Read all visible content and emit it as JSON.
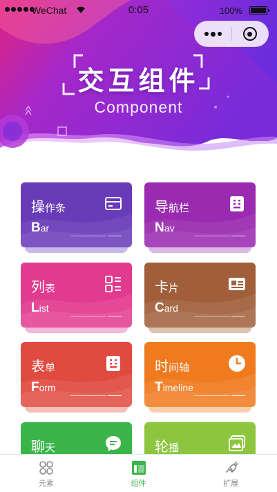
{
  "status_bar": {
    "carrier": "WeChat",
    "time": "0:05",
    "battery": "100%"
  },
  "capsule": {
    "more_icon": "more-dots-icon",
    "close_icon": "close-circle-icon"
  },
  "header": {
    "title_cn": "交互组件",
    "title_en": "Component",
    "gradient_from": "#e1237f",
    "gradient_to": "#7a2bd9"
  },
  "cards": [
    {
      "title_big": "操",
      "title_small": "作条",
      "sub_big": "B",
      "sub_small": "ar",
      "icon": "card-icon",
      "color": "#6a3bb8",
      "color2": "#7f48c9"
    },
    {
      "title_big": "导",
      "title_small": "航栏",
      "sub_big": "N",
      "sub_small": "av",
      "icon": "navigation-icon",
      "color": "#9a2bb0",
      "color2": "#a63dbd"
    },
    {
      "title_big": "列",
      "title_small": "表",
      "sub_big": "L",
      "sub_small": "ist",
      "icon": "list-icon",
      "color": "#e23a8f",
      "color2": "#e84d9a"
    },
    {
      "title_big": "卡",
      "title_small": "片",
      "sub_big": "C",
      "sub_small": "ard",
      "icon": "id-card-icon",
      "color": "#a05f3a",
      "color2": "#b06e48"
    },
    {
      "title_big": "表",
      "title_small": "单",
      "sub_big": "F",
      "sub_small": "orm",
      "icon": "form-icon",
      "color": "#e04a3f",
      "color2": "#e85b4f"
    },
    {
      "title_big": "时",
      "title_small": "间轴",
      "sub_big": "T",
      "sub_small": "imeline",
      "icon": "clock-icon",
      "color": "#f07a1e",
      "color2": "#f48a33"
    },
    {
      "title_big": "聊",
      "title_small": "天",
      "sub_big": "",
      "sub_small": "",
      "icon": "chat-icon",
      "color": "#3bb54a",
      "color2": "#4fc15c"
    },
    {
      "title_big": "轮",
      "title_small": "播",
      "sub_big": "",
      "sub_small": "",
      "icon": "image-swiper-icon",
      "color": "#8cc63f",
      "color2": "#9cd150"
    }
  ],
  "tabbar": {
    "items": [
      {
        "label": "元素",
        "icon": "elements-icon",
        "active": false
      },
      {
        "label": "组件",
        "icon": "component-icon",
        "active": true
      },
      {
        "label": "扩展",
        "icon": "extension-icon",
        "active": false
      }
    ],
    "active_color": "#39b54a"
  }
}
